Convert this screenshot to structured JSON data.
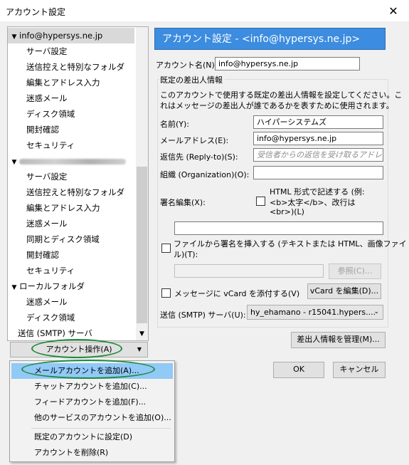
{
  "window": {
    "title": "アカウント設定",
    "close_glyph": "✕"
  },
  "tree": {
    "items": [
      {
        "text": "info@hypersys.ne.jp",
        "level": 0,
        "expanded": true,
        "selected": true
      },
      {
        "text": "サーバ設定",
        "level": 1
      },
      {
        "text": "送信控えと特別なフォルダ",
        "level": 1
      },
      {
        "text": "編集とアドレス入力",
        "level": 1
      },
      {
        "text": "迷惑メール",
        "level": 1
      },
      {
        "text": "ディスク領域",
        "level": 1
      },
      {
        "text": "開封確認",
        "level": 1
      },
      {
        "text": "セキュリティ",
        "level": 1
      },
      {
        "text": "",
        "level": 0,
        "expanded": true,
        "blurred": true
      },
      {
        "text": "サーバ設定",
        "level": 1
      },
      {
        "text": "送信控えと特別なフォルダ",
        "level": 1
      },
      {
        "text": "編集とアドレス入力",
        "level": 1
      },
      {
        "text": "迷惑メール",
        "level": 1
      },
      {
        "text": "同期とディスク領域",
        "level": 1
      },
      {
        "text": "開封確認",
        "level": 1
      },
      {
        "text": "セキュリティ",
        "level": 1
      },
      {
        "text": "ローカルフォルダ",
        "level": 0,
        "expanded": true
      },
      {
        "text": "迷惑メール",
        "level": 1
      },
      {
        "text": "ディスク領域",
        "level": 1
      },
      {
        "text": "送信 (SMTP) サーバ",
        "level": 0
      }
    ]
  },
  "account_actions": {
    "label": "アカウント操作(A)"
  },
  "menu": {
    "items": [
      {
        "label": "メールアカウントを追加(A)...",
        "highlighted": true
      },
      {
        "label": "チャットアカウントを追加(C)..."
      },
      {
        "label": "フィードアカウントを追加(F)..."
      },
      {
        "label": "他のサービスのアカウントを追加(O)..."
      },
      {
        "label": "既定のアカウントに設定(D)"
      },
      {
        "label": "アカウントを削除(R)"
      }
    ]
  },
  "panel": {
    "header": "アカウント設定 - <info@hypersys.ne.jp>",
    "account_name_label": "アカウント名(N):",
    "account_name_value": "info@hypersys.ne.jp",
    "identity_group_label": "既定の差出人情報",
    "identity_desc_1": "このアカウントで使用する既定の差出人情報を設定してください。こ",
    "identity_desc_2": "れはメッセージの差出人が誰であるかを表すために使用されます。",
    "name_label": "名前(Y):",
    "name_value": "ハイパーシステムズ",
    "email_label": "メールアドレス(E):",
    "email_value": "info@hypersys.ne.jp",
    "reply_label": "返信先 (Reply-to)(S):",
    "reply_placeholder": "受信者からの返信を受け取るアドレス",
    "org_label": "組織 (Organization)(O):",
    "org_value": "",
    "sig_label": "署名編集(X):",
    "html_sig_line1": "HTML 形式で記述する (例:",
    "html_sig_line2": "<b>太字</b>、改行は",
    "html_sig_line3": "<br>)(L)",
    "sig_file_line1": "ファイルから署名を挿入する (テキストまたは HTML、画像ファイ",
    "sig_file_line2": "ル)(T):",
    "browse_label": "参照(C)...",
    "vcard_label": "メッセージに vCard を添付する(V)",
    "vcard_edit_label": "vCard を編集(D)...",
    "smtp_label": "送信 (SMTP) サーバ(U):",
    "smtp_value": "hy_ehamano - r15041.hypers....",
    "manage_identities_label": "差出人情報を管理(M)...",
    "ok_label": "OK",
    "cancel_label": "キャンセル"
  },
  "colors": {
    "header_bg": "#3c8ce0",
    "menu_highlight": "#91c9f7",
    "annotation_oval": "#1e8a3a"
  }
}
